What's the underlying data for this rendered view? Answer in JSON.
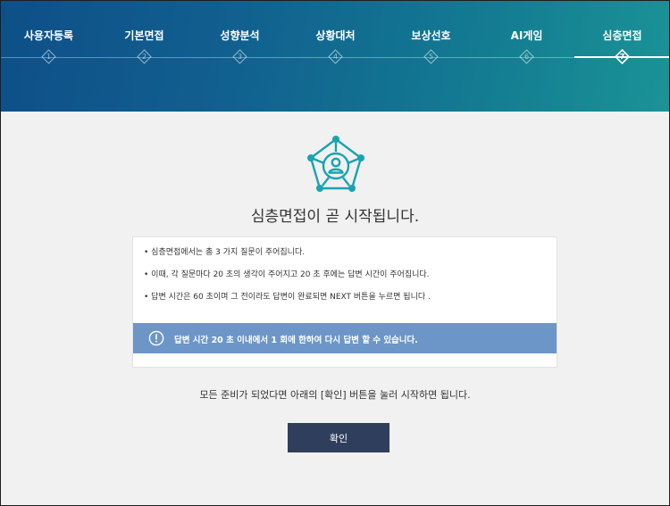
{
  "colors": {
    "header_start": "#0e4f88",
    "header_end": "#1a9396",
    "notice_bg": "#6d96c8",
    "confirm_bg": "#2f3e5d",
    "icon_teal": "#1aa3b3"
  },
  "header": {
    "steps": [
      {
        "label": "사용자등록",
        "number": "1",
        "active": false
      },
      {
        "label": "기본면접",
        "number": "2",
        "active": false
      },
      {
        "label": "성향분석",
        "number": "3",
        "active": false
      },
      {
        "label": "상황대처",
        "number": "4",
        "active": false
      },
      {
        "label": "보상선호",
        "number": "5",
        "active": false
      },
      {
        "label": "AI게임",
        "number": "6",
        "active": false
      },
      {
        "label": "심층면접",
        "number": "7",
        "active": true
      }
    ]
  },
  "main": {
    "icon": "network-person-icon",
    "title": "심층면접이 곧 시작됩니다.",
    "rules": [
      "• 심층면접에서는 총 3 가지 질문이 주어집니다.",
      "• 이때, 각 질문마다 20 초의 생각이 주어지고 20 초 후에는 답변 시간이 주어집니다.",
      "• 답변 시간은 60 초이며 그 전이라도 답변이 완료되면 NEXT 버튼을 누르면 됩니다 ."
    ],
    "notice": "답변 시간 20 초 이내에서 1 회에 한하여 다시 답변 할 수 있습니다.",
    "ready_text": "모든 준비가 되었다면 아래의 [확인] 버튼을 눌러 시작하면 됩니다.",
    "confirm_label": "확인"
  }
}
